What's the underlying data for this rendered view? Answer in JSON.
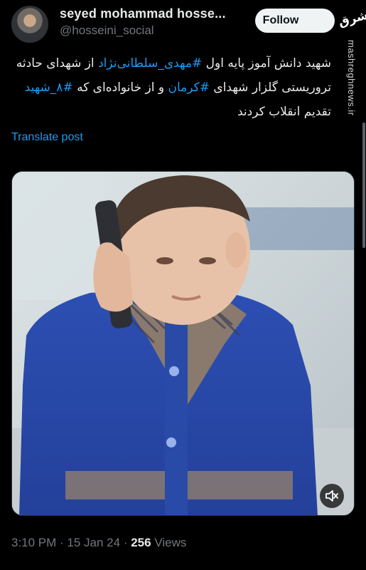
{
  "tweet": {
    "author_name": "seyed mohammad hosse...",
    "author_handle": "@hosseini_social",
    "follow_label": "Follow",
    "text_parts": {
      "p1": "شهید دانش آموز پایه اول ",
      "h1": "#مهدی_سلطانی‌نژاد",
      "p2": " از شهدای حادثه تروریستی گلزار شهدای ",
      "h2": "#کرمان",
      "p3": " و از خانواده‌ای که ",
      "h3": "#۸_شهید",
      "p4": " تقدیم انقلاب کردند"
    },
    "translate_label": "Translate post",
    "time": "3:10 PM",
    "sep1": " · ",
    "date": "15 Jan 24",
    "sep2": " · ",
    "views_count": "256",
    "views_label": " Views"
  },
  "watermark": {
    "logo_text": "مشرق",
    "site_text": "mashreghnews.ir"
  },
  "icons": {
    "mute": "speaker-muted-icon",
    "avatar": "avatar"
  },
  "colors": {
    "background": "#000000",
    "link": "#1d9bf0",
    "secondary_text": "#71767b",
    "follow_bg": "#eff3f4"
  }
}
